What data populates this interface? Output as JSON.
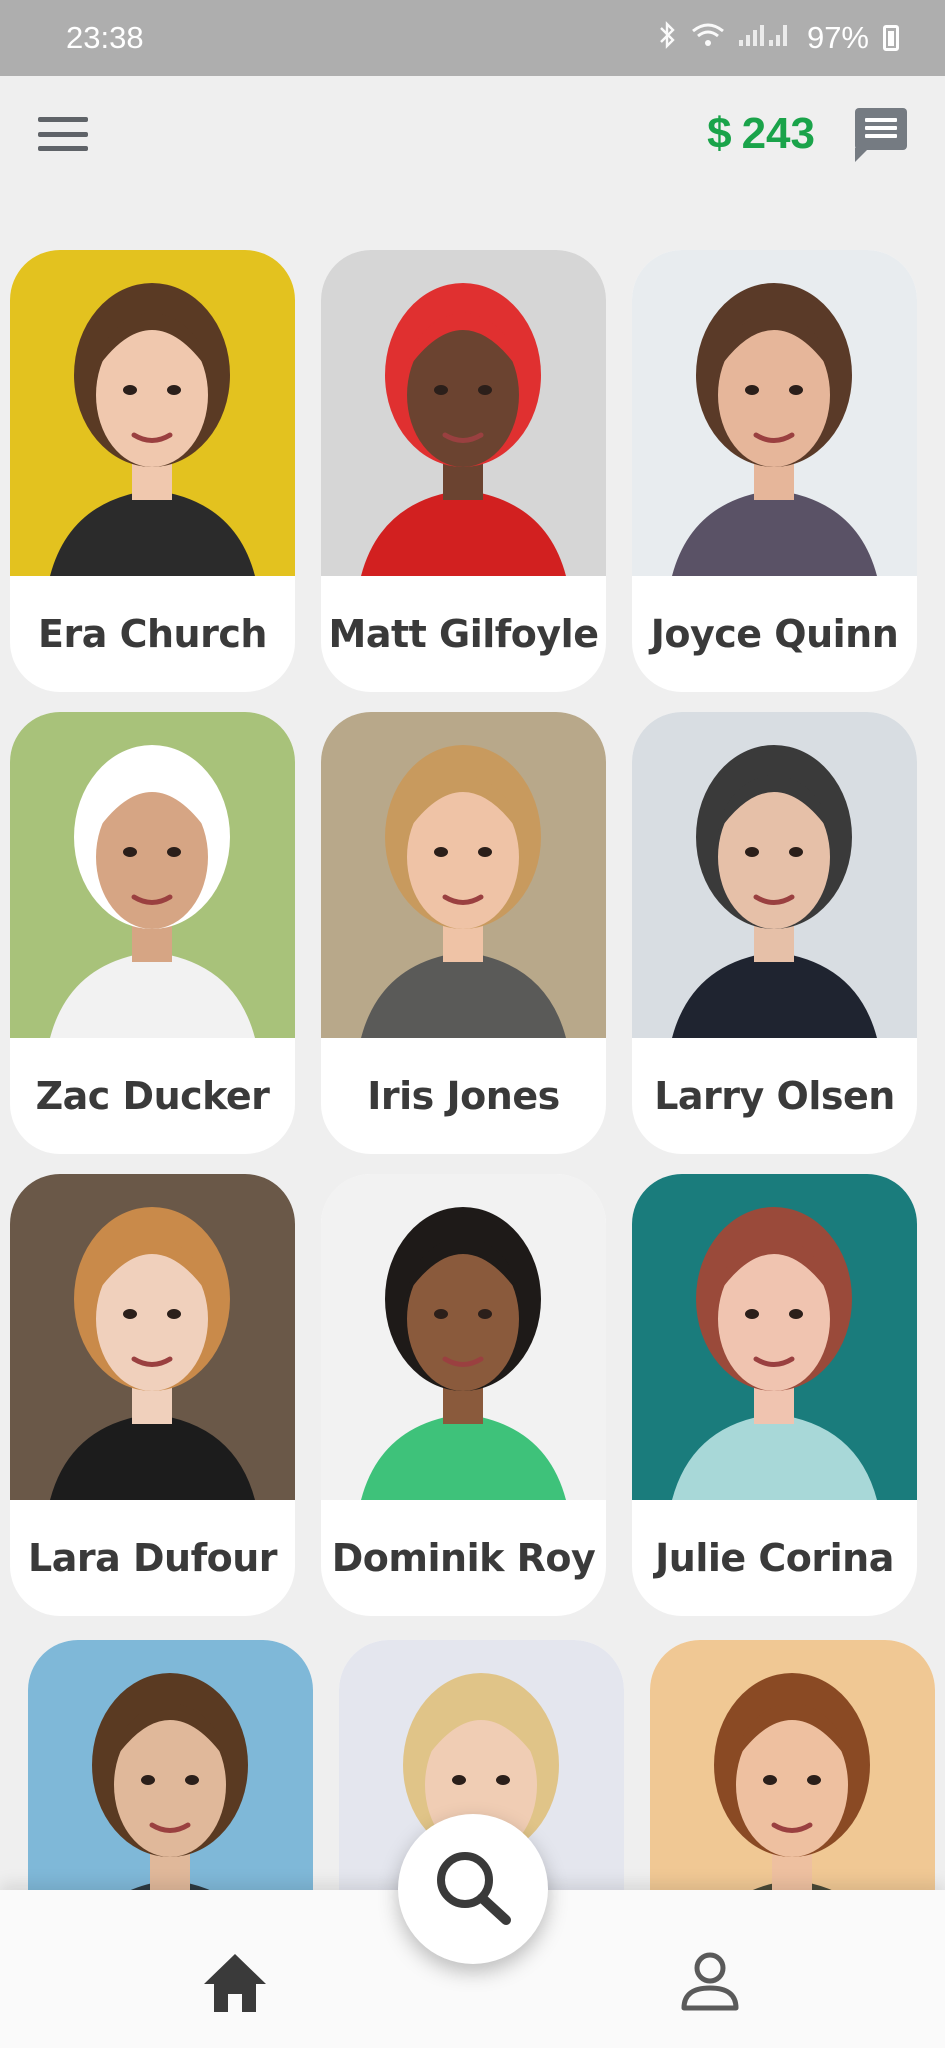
{
  "status_bar": {
    "time": "23:38",
    "battery": "97%",
    "icons": [
      "bluetooth-icon",
      "wifi-icon",
      "signal-icon",
      "battery-charging-icon"
    ]
  },
  "header": {
    "currency": "$",
    "balance": "243",
    "accent_color": "#1aa34a"
  },
  "profiles": [
    {
      "name": "Era Church",
      "bg": "#e3c21f",
      "skin": "#f0c8ae",
      "hair": "#5a3a24",
      "shirt": "#2b2b2b"
    },
    {
      "name": "Matt Gilfoyle",
      "bg": "#d6d6d6",
      "skin": "#6b4330",
      "hair": "#e03030",
      "shirt": "#d22020"
    },
    {
      "name": "Joyce Quinn",
      "bg": "#e8ecef",
      "skin": "#e6b69a",
      "hair": "#5a3a28",
      "shirt": "#5a5266"
    },
    {
      "name": "Zac Ducker",
      "bg": "#a8c27a",
      "skin": "#d6a584",
      "hair": "#ffffff",
      "shirt": "#f2f2f2"
    },
    {
      "name": "Iris Jones",
      "bg": "#b8a88a",
      "skin": "#efc3a6",
      "hair": "#c89a5e",
      "shirt": "#5a5a58"
    },
    {
      "name": "Larry Olsen",
      "bg": "#d8dde2",
      "skin": "#e6c0a8",
      "hair": "#3a3a3a",
      "shirt": "#1f2430"
    },
    {
      "name": "Lara Dufour",
      "bg": "#6a5848",
      "skin": "#f0d0bc",
      "hair": "#c98a4a",
      "shirt": "#1c1c1c"
    },
    {
      "name": "Dominik Roy",
      "bg": "#f2f2f2",
      "skin": "#8a5a3c",
      "hair": "#1e1a18",
      "shirt": "#3ec27a"
    },
    {
      "name": "Julie Corina",
      "bg": "#1a7c7c",
      "skin": "#f0c4b0",
      "hair": "#9a4a3a",
      "shirt": "#a8d8d8"
    },
    {
      "name": "",
      "bg": "#7fb8d8",
      "skin": "#e0b89a",
      "hair": "#5a3a22",
      "shirt": "#2e3a40"
    },
    {
      "name": "",
      "bg": "#e4e6ee",
      "skin": "#f0cdb4",
      "hair": "#e0c488",
      "shirt": "#f4f4f4"
    },
    {
      "name": "",
      "bg": "#f0c894",
      "skin": "#eec0a0",
      "hair": "#8a4a24",
      "shirt": "#4a4a38"
    }
  ],
  "nav": {
    "items": [
      "home-icon",
      "search-icon",
      "profile-icon"
    ]
  }
}
